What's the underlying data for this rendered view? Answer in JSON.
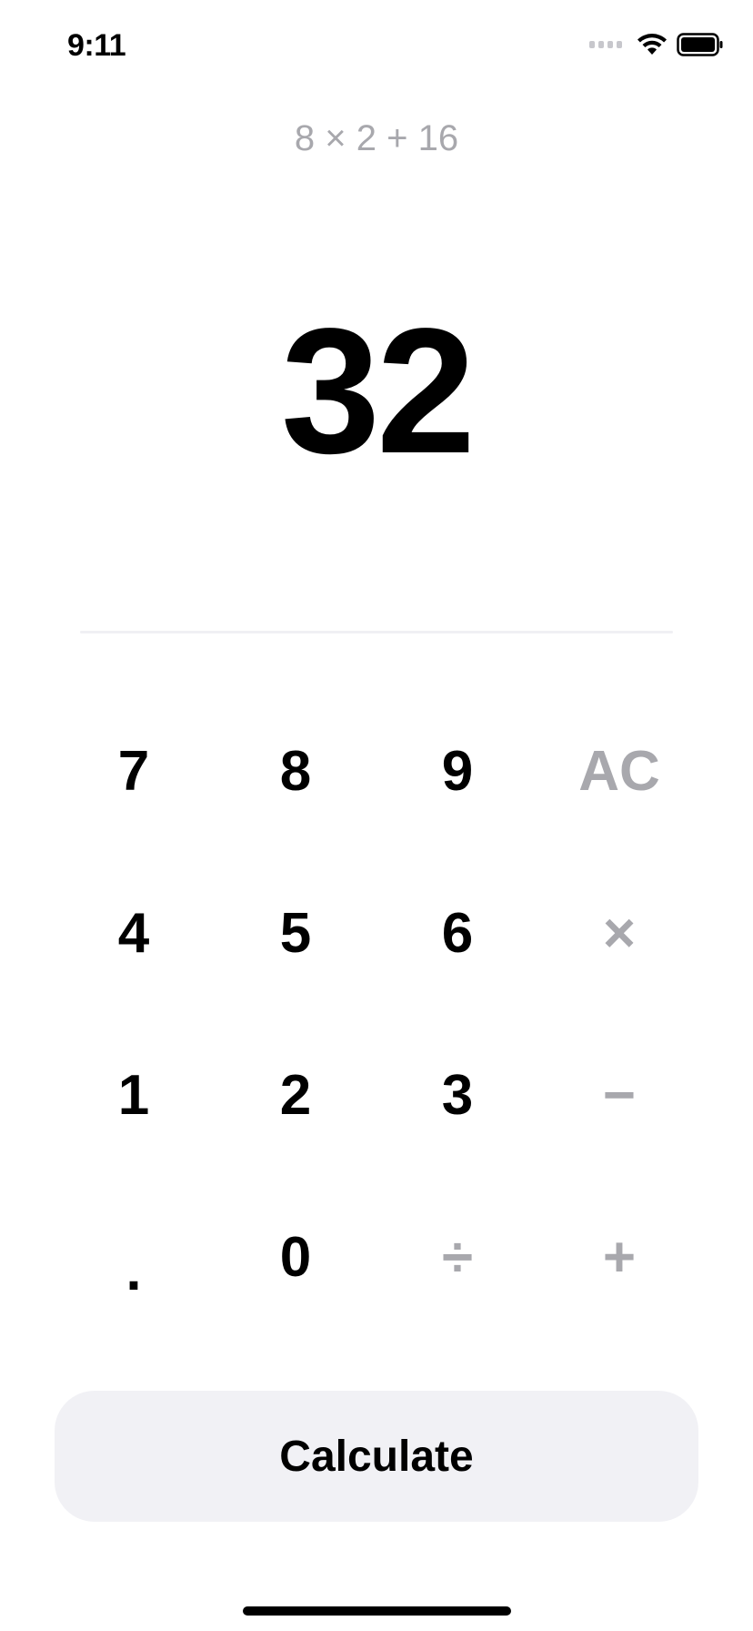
{
  "status_bar": {
    "time": "9:11",
    "icons": [
      "cellular-signal-icon",
      "wifi-icon",
      "battery-icon"
    ]
  },
  "display": {
    "expression": "8 × 2 + 16",
    "result": "32"
  },
  "keypad": {
    "keys": [
      {
        "label": "7",
        "kind": "digit"
      },
      {
        "label": "8",
        "kind": "digit"
      },
      {
        "label": "9",
        "kind": "digit"
      },
      {
        "label": "AC",
        "kind": "op"
      },
      {
        "label": "4",
        "kind": "digit"
      },
      {
        "label": "5",
        "kind": "digit"
      },
      {
        "label": "6",
        "kind": "digit"
      },
      {
        "label": "×",
        "kind": "op"
      },
      {
        "label": "1",
        "kind": "digit"
      },
      {
        "label": "2",
        "kind": "digit"
      },
      {
        "label": "3",
        "kind": "digit"
      },
      {
        "label": "−",
        "kind": "op"
      },
      {
        "label": ".",
        "kind": "digit"
      },
      {
        "label": "0",
        "kind": "digit"
      },
      {
        "label": "÷",
        "kind": "op"
      },
      {
        "label": "+",
        "kind": "op"
      }
    ]
  },
  "actions": {
    "calculate_label": "Calculate"
  },
  "colors": {
    "primary_text": "#000000",
    "muted_text": "#a8a8ad",
    "button_background": "#f1f1f5",
    "background": "#ffffff"
  }
}
